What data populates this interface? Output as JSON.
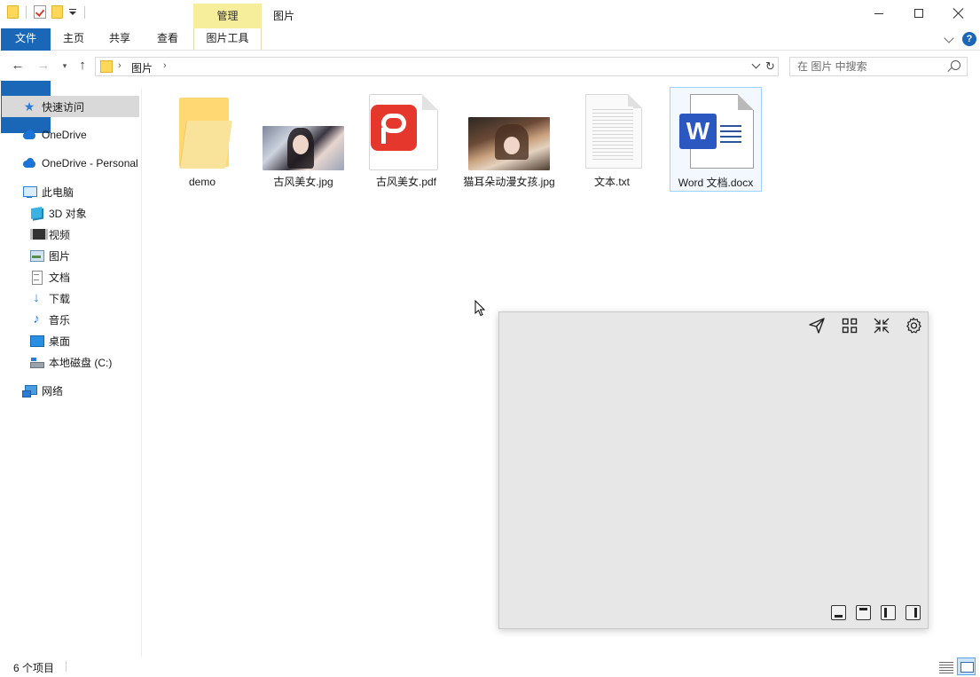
{
  "window": {
    "title": "图片",
    "context_tab": "管理"
  },
  "ribbon": {
    "tabs": [
      "文件",
      "主页",
      "共享",
      "查看",
      "图片工具"
    ],
    "help_label": "?"
  },
  "address": {
    "path": "图片",
    "search_placeholder": "在 图片 中搜索"
  },
  "sidebar": {
    "items": [
      {
        "label": "快速访问",
        "icon": "star-icon",
        "level": 1,
        "selected": true
      },
      {
        "label": "OneDrive",
        "icon": "onedrive-cloud-icon",
        "level": 1
      },
      {
        "label": "OneDrive - Personal",
        "icon": "onedrive-cloud-icon",
        "level": 1
      },
      {
        "label": "此电脑",
        "icon": "computer-icon",
        "level": 1
      },
      {
        "label": "3D 对象",
        "icon": "3d-objects-icon",
        "level": 2
      },
      {
        "label": "视频",
        "icon": "video-icon",
        "level": 2
      },
      {
        "label": "图片",
        "icon": "pictures-icon",
        "level": 2
      },
      {
        "label": "文档",
        "icon": "documents-icon",
        "level": 2
      },
      {
        "label": "下载",
        "icon": "download-icon",
        "level": 2
      },
      {
        "label": "音乐",
        "icon": "music-icon",
        "level": 2
      },
      {
        "label": "桌面",
        "icon": "desktop-icon",
        "level": 2
      },
      {
        "label": "本地磁盘 (C:)",
        "icon": "local-disk-icon",
        "level": 2
      },
      {
        "label": "网络",
        "icon": "network-icon",
        "level": 1
      }
    ]
  },
  "files": [
    {
      "name": "demo",
      "type": "folder"
    },
    {
      "name": "古风美女.jpg",
      "type": "image"
    },
    {
      "name": "古风美女.pdf",
      "type": "pdf"
    },
    {
      "name": "猫耳朵动漫女孩.jpg",
      "type": "image"
    },
    {
      "name": "文本.txt",
      "type": "text"
    },
    {
      "name": "Word 文档.docx",
      "type": "word",
      "selected": true
    }
  ],
  "file_icons": {
    "word_letter": "W"
  },
  "status": {
    "item_count": "6 个项目"
  },
  "colors": {
    "accent": "#1a67b8",
    "context_tab": "#f7ee9b",
    "selection": "#99d1ff",
    "panel_bg": "#e7e7e7"
  }
}
